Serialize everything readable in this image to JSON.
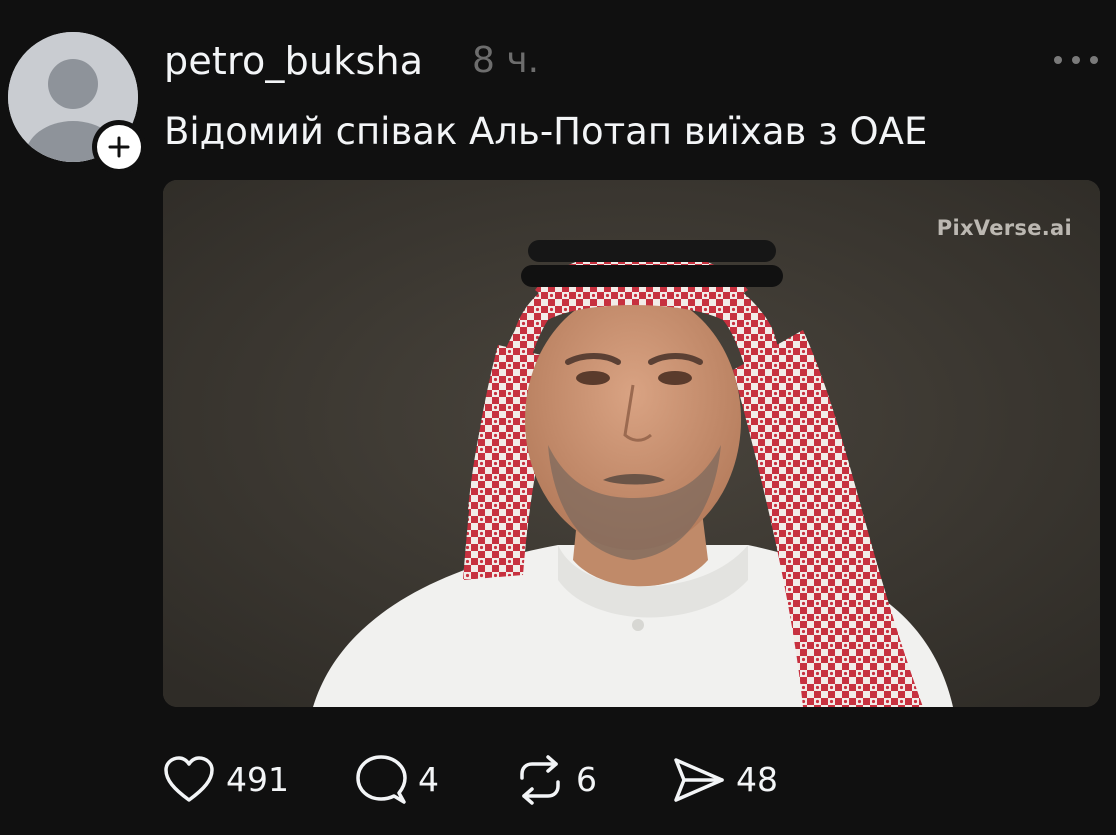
{
  "post": {
    "username": "petro_buksha",
    "timestamp": "8 ч.",
    "text": "Відомий співак Аль-Потап виїхав з ОАЕ",
    "media": {
      "watermark": "PixVerse.ai"
    },
    "actions": {
      "likes": "491",
      "comments": "4",
      "reposts": "6",
      "shares": "48"
    }
  },
  "icons": {
    "avatar": "default-avatar-icon",
    "follow": "plus-icon",
    "more": "more-horizontal-icon",
    "like": "heart-icon",
    "comment": "comment-bubble-icon",
    "repost": "repost-icon",
    "share": "send-icon"
  },
  "colors": {
    "background": "#101010",
    "primary_text": "#f3f5f7",
    "secondary_text": "#6d6d6d",
    "avatar_bg": "#c9ccd1"
  }
}
